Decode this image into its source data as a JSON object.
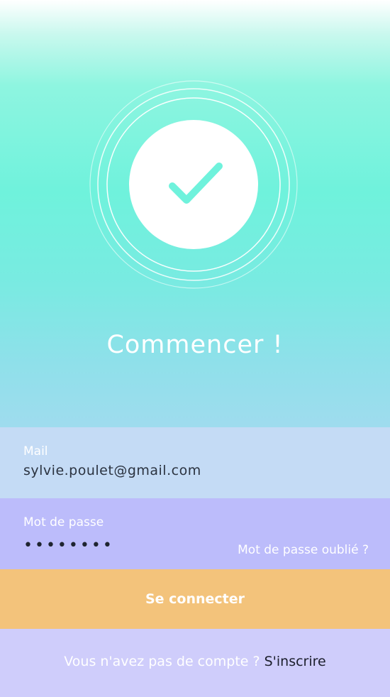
{
  "hero": {
    "title": "Commencer !",
    "icon": "check-icon",
    "colors": {
      "gradient_top": "#ffffff",
      "gradient_mid": "#6ff2dc",
      "gradient_bottom": "#9fdcee",
      "check": "#6ff2dc"
    }
  },
  "form": {
    "mail": {
      "label": "Mail",
      "value": "sylvie.poulet@gmail.com"
    },
    "password": {
      "label": "Mot de passe",
      "value": "••••••••",
      "forgot_label": "Mot de passe oublié ?"
    }
  },
  "actions": {
    "connect_label": "Se connecter",
    "connect_color": "#f3c37b"
  },
  "footer": {
    "question": "Vous n'avez pas de compte ?",
    "signup_label": "S'inscrire"
  }
}
